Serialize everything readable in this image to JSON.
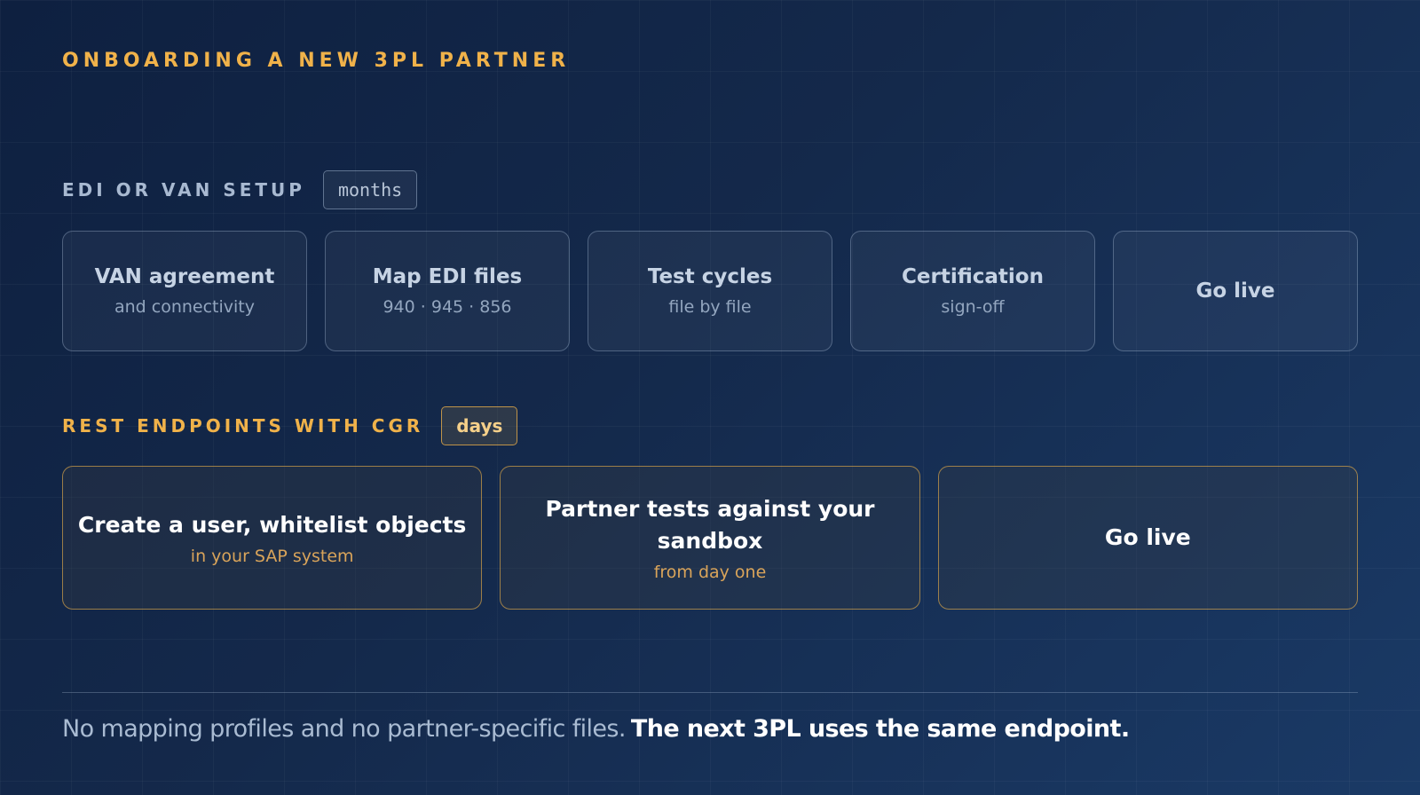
{
  "title": "ONBOARDING A NEW 3PL PARTNER",
  "edi": {
    "label": "EDI OR VAN SETUP",
    "duration": "months",
    "steps": [
      {
        "title": "VAN agreement",
        "sub": "and connectivity"
      },
      {
        "title": "Map EDI files",
        "sub": "940 · 945 · 856"
      },
      {
        "title": "Test cycles",
        "sub": "file by file"
      },
      {
        "title": "Certification",
        "sub": "sign-off"
      },
      {
        "title": "Go live"
      }
    ]
  },
  "rest": {
    "label": "REST ENDPOINTS WITH CGR",
    "duration": "days",
    "steps": [
      {
        "title": "Create a user, whitelist objects",
        "sub": "in your SAP system"
      },
      {
        "title": "Partner tests against your sandbox",
        "sub": "from day one"
      },
      {
        "title": "Go live"
      }
    ]
  },
  "footer": {
    "text": "No mapping profiles and no partner-specific files.",
    "emphasis": "The next 3PL uses the same endpoint."
  }
}
